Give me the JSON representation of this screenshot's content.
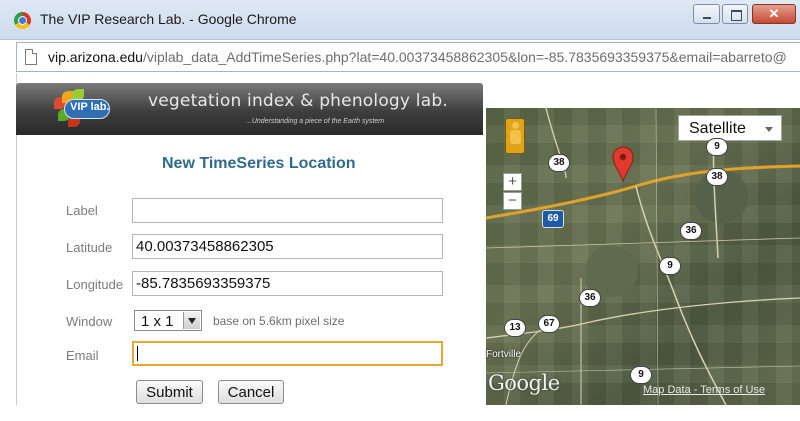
{
  "window": {
    "title": "The VIP Research Lab. - Google Chrome",
    "url_host": "vip.arizona.edu",
    "url_path": "/viplab_data_AddTimeSeries.php?lat=40.00373458862305&lon=-85.7835693359375&email=abarreto@"
  },
  "banner": {
    "logo_text": "VIP lab.",
    "title": "vegetation index & phenology lab.",
    "subtitle": "...Understanding a piece of the Earth system"
  },
  "form": {
    "title": "New TimeSeries Location",
    "label_label": "Label",
    "label_value": "",
    "latitude_label": "Latitude",
    "latitude_value": "40.00373458862305",
    "longitude_label": "Longitude",
    "longitude_value": "-85.7835693359375",
    "window_label": "Window",
    "window_value": "1 x 1",
    "window_hint": "base on 5.6km pixel size",
    "email_label": "Email",
    "email_value": "",
    "submit_label": "Submit",
    "cancel_label": "Cancel"
  },
  "map": {
    "type_selected": "Satellite",
    "zoom_in": "+",
    "zoom_out": "−",
    "road_labels": [
      "38",
      "9",
      "38",
      "69",
      "36",
      "9",
      "36",
      "13",
      "67",
      "9"
    ],
    "town": "Fortville",
    "logo": "Google",
    "map_data_link": "Map Data",
    "terms_link": "Terms of Use",
    "footer_sep": " - "
  },
  "colors": {
    "title_accent": "#2f6b8f",
    "focus_border": "#e5a73a",
    "pin_red": "#e03a2e",
    "road_orange": "#e0a32a",
    "interstate_blue": "#1f5aa6"
  }
}
